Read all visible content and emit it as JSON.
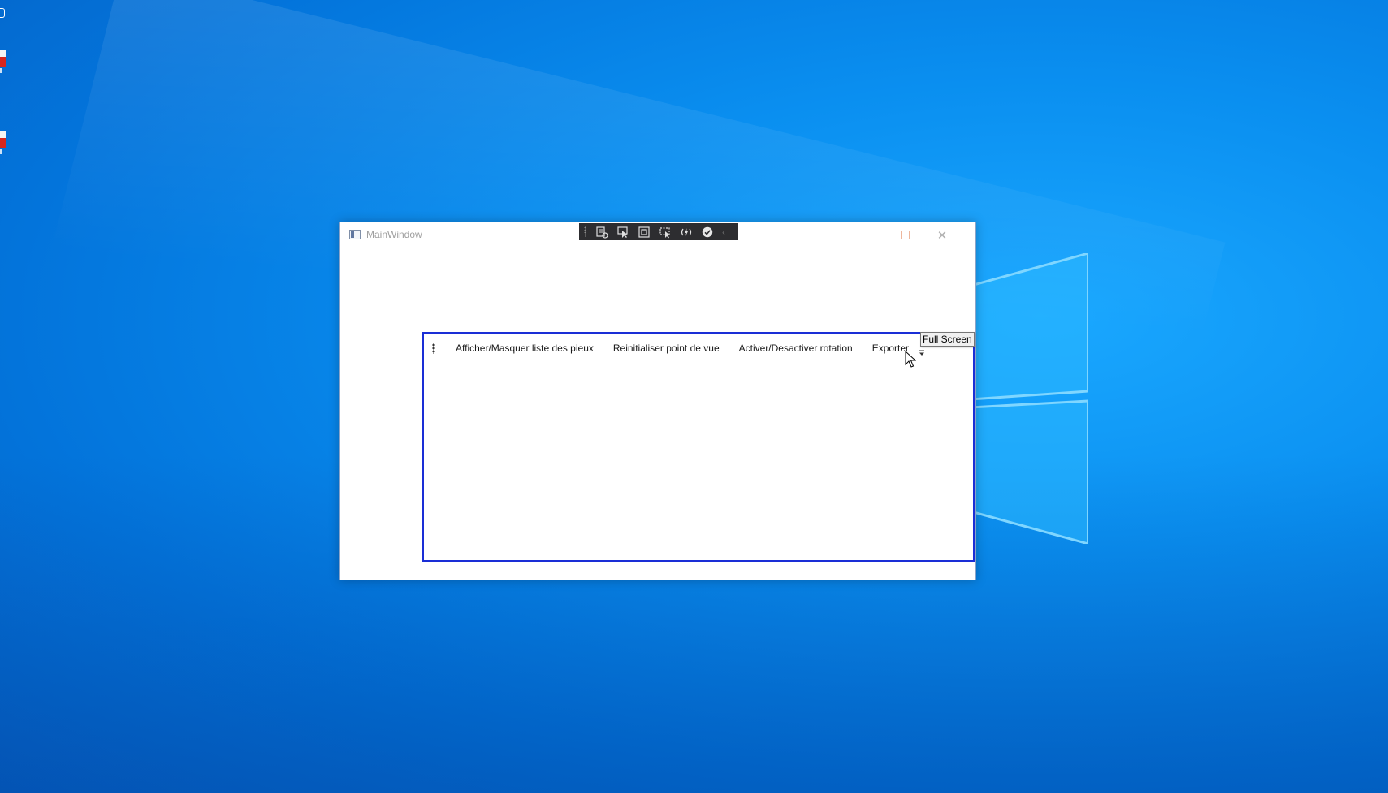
{
  "window": {
    "title": "MainWindow"
  },
  "debug_toolbar": {
    "buttons": [
      {
        "icon": "live-visual-tree-icon"
      },
      {
        "icon": "select-element-icon"
      },
      {
        "icon": "display-layout-adorners-icon"
      },
      {
        "icon": "track-focused-element-icon"
      },
      {
        "icon": "hot-reload-icon"
      },
      {
        "icon": "binding-failures-icon"
      }
    ],
    "collapse_icon": "chevron-left-icon"
  },
  "toolbar": {
    "buttons": [
      {
        "label": "Afficher/Masquer liste des pieux"
      },
      {
        "label": "Reinitialiser point de vue"
      },
      {
        "label": "Activer/Desactiver rotation"
      },
      {
        "label": "Exporter"
      }
    ],
    "overflow_icon": "overflow-chevron-icon"
  },
  "tooltip": {
    "text": "Full Screen"
  },
  "colors": {
    "desktop_blue": "#0a8ff0",
    "panel_border": "#1a2ed6",
    "debug_toolbar_bg": "#2d2d30"
  }
}
